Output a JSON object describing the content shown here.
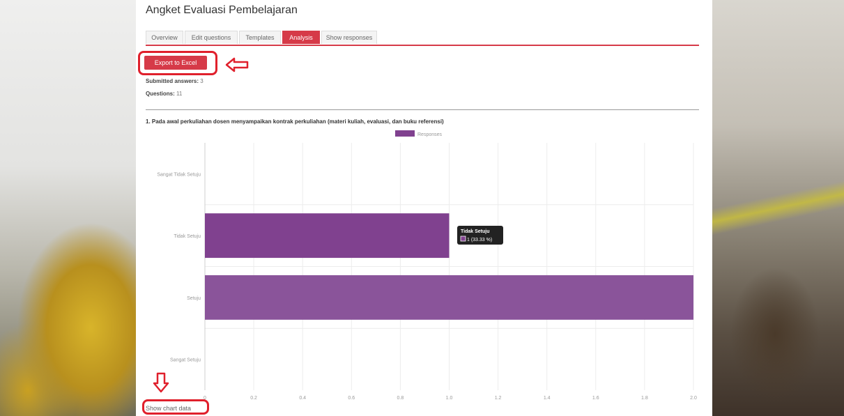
{
  "page": {
    "title": "Angket Evaluasi Pembelajaran",
    "tabs": [
      {
        "label": "Overview",
        "active": false
      },
      {
        "label": "Edit questions",
        "active": false
      },
      {
        "label": "Templates",
        "active": false
      },
      {
        "label": "Analysis",
        "active": true
      },
      {
        "label": "Show responses",
        "active": false
      }
    ],
    "export_label": "Export to Excel",
    "submitted_label": "Submitted answers:",
    "submitted_value": "3",
    "questions_label": "Questions:",
    "questions_value": "11",
    "question_text": "1. Pada awal perkuliahan dosen menyampaikan kontrak perkuliahan (materi kuliah, evaluasi, dan buku referensi)",
    "show_chart_data": "Show chart data"
  },
  "colors": {
    "accent": "#d63a48",
    "bar": "#80418f",
    "bar_light": "#8a549a",
    "highlight": "#e0202c"
  },
  "chart_data": {
    "type": "bar",
    "orientation": "horizontal",
    "categories": [
      "Sangat Tidak Setuju",
      "Tidak Setuju",
      "Setuju",
      "Sangat Setuju"
    ],
    "series": [
      {
        "name": "Responses",
        "values": [
          0,
          1,
          2,
          0
        ]
      }
    ],
    "xlim": [
      0,
      2.0
    ],
    "xticks": [
      "0",
      "0.2",
      "0.4",
      "0.6",
      "0.8",
      "1.0",
      "1.2",
      "1.4",
      "1.6",
      "1.8",
      "2.0"
    ],
    "grid": true,
    "legend": "top",
    "tooltip": {
      "title": "Tidak Setuju",
      "value": "1 (33.33 %)"
    }
  }
}
